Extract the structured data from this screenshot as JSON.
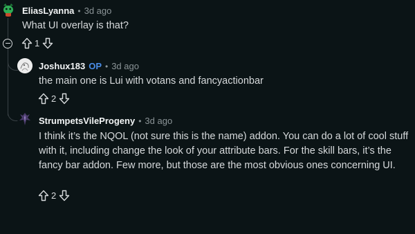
{
  "comments": [
    {
      "username": "EliasLyanna",
      "op_badge": "",
      "separator": "•",
      "time": "3d ago",
      "text": "What UI overlay is that?",
      "votes": "1"
    },
    {
      "username": "Joshux183",
      "op_badge": "OP",
      "separator": "•",
      "time": "3d ago",
      "text": "the main one is Lui with votans and fancyactionbar",
      "votes": "2"
    },
    {
      "username": "StrumpetsVileProgeny",
      "op_badge": "",
      "separator": "•",
      "time": "3d ago",
      "text": "I think it’s the NQOL (not sure this is the name) addon. You can do a lot of cool stuff with it, including change the look of your attribute bars. For the skill bars, it’s the fancy bar addon. Few more, but those are the most obvious ones concerning UI.",
      "votes": "2"
    }
  ],
  "colors": {
    "background": "#0b1416",
    "text": "#d7dadc",
    "username": "#f2f4f5",
    "muted": "#8b9497",
    "op_accent": "#4a8de8",
    "thread_line": "#3a4246"
  },
  "icons": {
    "upvote": "arrow-up-outline-icon",
    "downvote": "arrow-down-outline-icon",
    "collapse": "collapse-minus-icon"
  }
}
